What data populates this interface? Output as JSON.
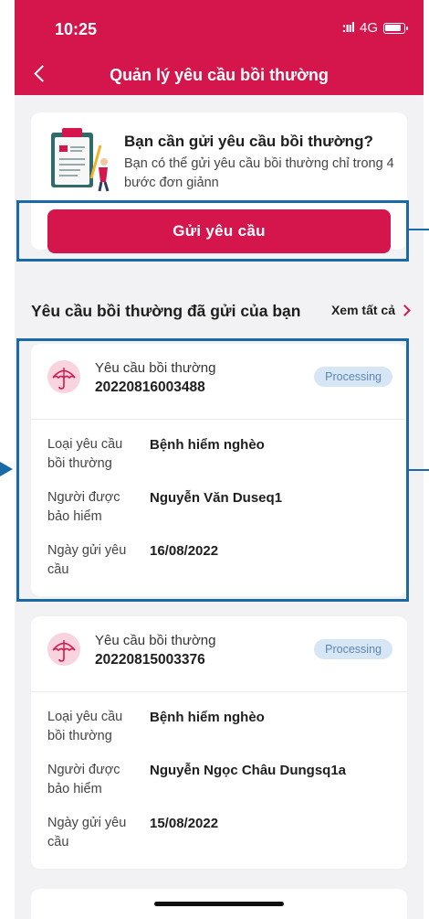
{
  "status_bar": {
    "time": "10:25",
    "signal": ":ııl",
    "network": "4G"
  },
  "header": {
    "title": "Quản lý yêu cầu bồi thường"
  },
  "promo": {
    "title": "Bạn cần gửi yêu cầu bồi thường?",
    "description": "Bạn có thể gửi yêu cầu bồi thường chỉ trong 4 bước đơn giảnn",
    "button_label": "Gửi yêu cầu"
  },
  "section": {
    "title": "Yêu cầu bồi thường đã gửi của bạn",
    "view_all": "Xem tất cả"
  },
  "claims": [
    {
      "label": "Yêu cầu bồi thường",
      "number": "20220816003488",
      "status": "Processing",
      "fields": [
        {
          "label": "Loại yêu cầu bồi thường",
          "value": "Bệnh hiểm nghèo"
        },
        {
          "label": "Người được bảo hiểm",
          "value": "Nguyễn Văn Duseq1"
        },
        {
          "label": "Ngày gửi yêu cầu",
          "value": "16/08/2022"
        }
      ]
    },
    {
      "label": "Yêu cầu bồi thường",
      "number": "20220815003376",
      "status": "Processing",
      "fields": [
        {
          "label": "Loại yêu cầu bồi thường",
          "value": "Bệnh hiểm nghèo"
        },
        {
          "label": "Người được bảo hiểm",
          "value": "Nguyễn Ngọc Châu Dungsq1a"
        },
        {
          "label": "Ngày gửi yêu cầu",
          "value": "15/08/2022"
        }
      ]
    }
  ],
  "colors": {
    "brand": "#d4164c",
    "highlight": "#1a6aa8",
    "badge_bg": "#d7e6f4",
    "badge_text": "#5c87b2"
  },
  "icons": [
    "back-chevron-icon",
    "battery-icon",
    "clipboard-illustration",
    "umbrella-icon",
    "chevron-right-icon"
  ]
}
